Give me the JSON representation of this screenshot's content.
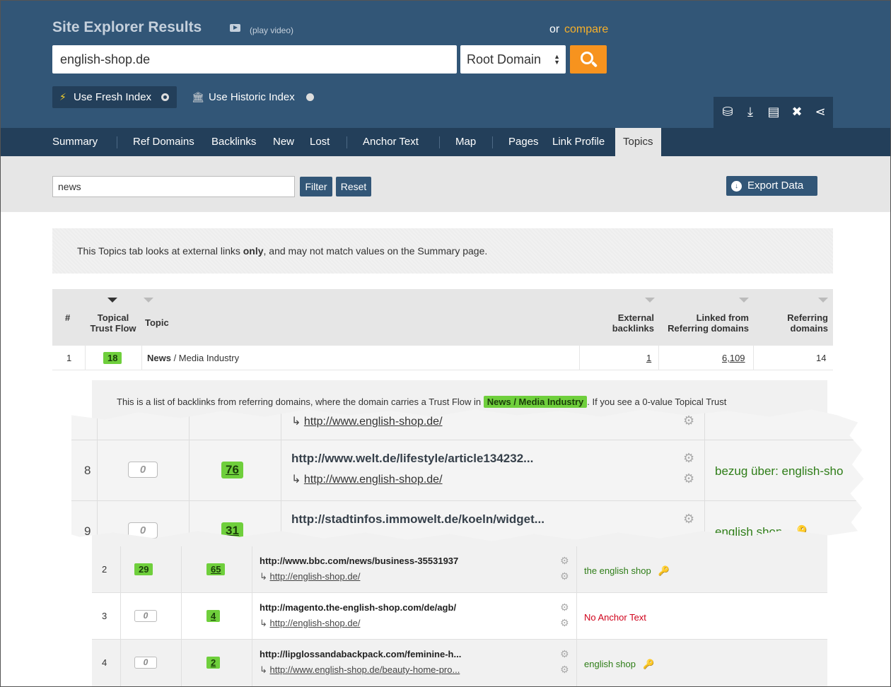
{
  "header": {
    "title": "Site Explorer Results",
    "play_video": "(play video)",
    "or_label": "or",
    "compare_link": "compare",
    "domain_value": "english-shop.de",
    "scope_value": "Root Domain",
    "fresh_index": "Use Fresh Index",
    "historic_index": "Use Historic Index"
  },
  "toolbar": {
    "icons": [
      "bucket-add-icon",
      "download-icon",
      "report-icon",
      "tools-icon",
      "share-icon"
    ]
  },
  "nav": {
    "tabs": [
      {
        "label": "Summary"
      },
      {
        "label": "Ref Domains"
      },
      {
        "label": "Backlinks"
      },
      {
        "label": "New"
      },
      {
        "label": "Lost"
      },
      {
        "label": "Anchor Text"
      },
      {
        "label": "Map"
      },
      {
        "label": "Pages"
      },
      {
        "label": "Link Profile"
      },
      {
        "label": "Topics"
      }
    ],
    "active": "Topics"
  },
  "filter": {
    "value": "news",
    "filter_label": "Filter",
    "reset_label": "Reset",
    "export_label": "Export Data"
  },
  "notice": {
    "before": "This Topics tab looks at external links ",
    "bold": "only",
    "after": ", and may not match values on the Summary page."
  },
  "topics_table": {
    "headers": {
      "num": "#",
      "ttf_line1": "Topical",
      "ttf_line2": "Trust Flow",
      "topic": "Topic",
      "ext_line1": "External",
      "ext_line2": "backlinks",
      "linked_line1": "Linked from",
      "linked_line2": "Referring domains",
      "ref_line1": "Referring",
      "ref_line2": "domains"
    },
    "row": {
      "num": "1",
      "ttf": "18",
      "topic_bold": "News",
      "topic_rest": " / Media Industry",
      "external": "1",
      "linked": "6,109",
      "referring": "14"
    }
  },
  "sub_note": {
    "before": "This is a list of backlinks from referring domains, where the domain carries a Trust Flow in ",
    "highlight": "News / Media Industry",
    "after": ". If you see a 0-value Topical Trust"
  },
  "zoom_rows": [
    {
      "num": "8",
      "zero": "0",
      "tf": "76",
      "url": "http://www.welt.de/lifestyle/article134232...",
      "target": "http://www.english-shop.de/",
      "anchor": "bezug über: english-sho"
    },
    {
      "num": "9",
      "zero": "0",
      "tf": "31",
      "url": "http://stadtinfos.immowelt.de/koeln/widget...",
      "target": "",
      "anchor": "english shop"
    }
  ],
  "zoom_top_partial": {
    "target": "http://www.english-shop.de/"
  },
  "backlink_rows": [
    {
      "num": "2",
      "ttf": "29",
      "tf": "65",
      "url": "http://www.bbc.com/news/business-35531937",
      "target": "http://english-shop.de/",
      "anchor": "the english shop",
      "anchor_kind": "normal",
      "has_key": true
    },
    {
      "num": "3",
      "ttf": "0",
      "tf": "4",
      "url": "http://magento.the-english-shop.com/de/agb/",
      "target": "http://english-shop.de/",
      "anchor": "No Anchor Text",
      "anchor_kind": "none",
      "has_key": false
    },
    {
      "num": "4",
      "ttf": "0",
      "tf": "2",
      "url": "http://lipglossandabackpack.com/feminine-h...",
      "target": "http://www.english-shop.de/beauty-home-pro...",
      "anchor": "english shop",
      "anchor_kind": "normal",
      "has_key": true
    }
  ],
  "colors": {
    "header_bg": "#325677",
    "nav_bg": "#233f5a",
    "accent_orange": "#f7931e",
    "compare_link": "#f7b02a",
    "badge_green": "#6fcf3c",
    "anchor_green": "#2e7d17",
    "anchor_red": "#d0021b"
  }
}
